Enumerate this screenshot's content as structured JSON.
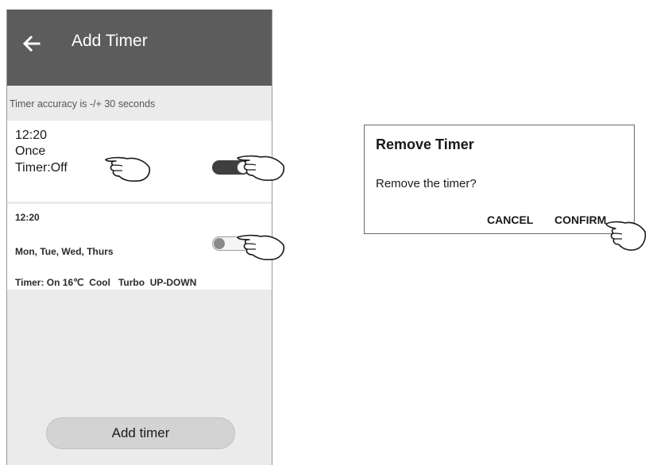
{
  "header": {
    "title": "Add Timer",
    "back_icon": "arrow-left-icon"
  },
  "accuracy_note": "Timer accuracy is -/+ 30 seconds",
  "timers": [
    {
      "time": "12:20",
      "repeat": "Once",
      "detail": "Timer:Off",
      "enabled": true
    },
    {
      "time": "12:20",
      "repeat": "Mon, Tue, Wed, Thurs",
      "detail": "Timer: On 16℃  Cool   Turbo  UP-DOWN",
      "enabled": false
    }
  ],
  "add_button_label": "Add timer",
  "dialog": {
    "title": "Remove Timer",
    "message": "Remove the timer?",
    "cancel_label": "CANCEL",
    "confirm_label": "CONFIRM"
  },
  "colors": {
    "header_bg": "#5c5c5c",
    "screen_bg": "#ebebeb",
    "toggle_on": "#3f3f3f"
  },
  "icons": [
    "arrow-left-icon",
    "pointing-hand-icon"
  ]
}
